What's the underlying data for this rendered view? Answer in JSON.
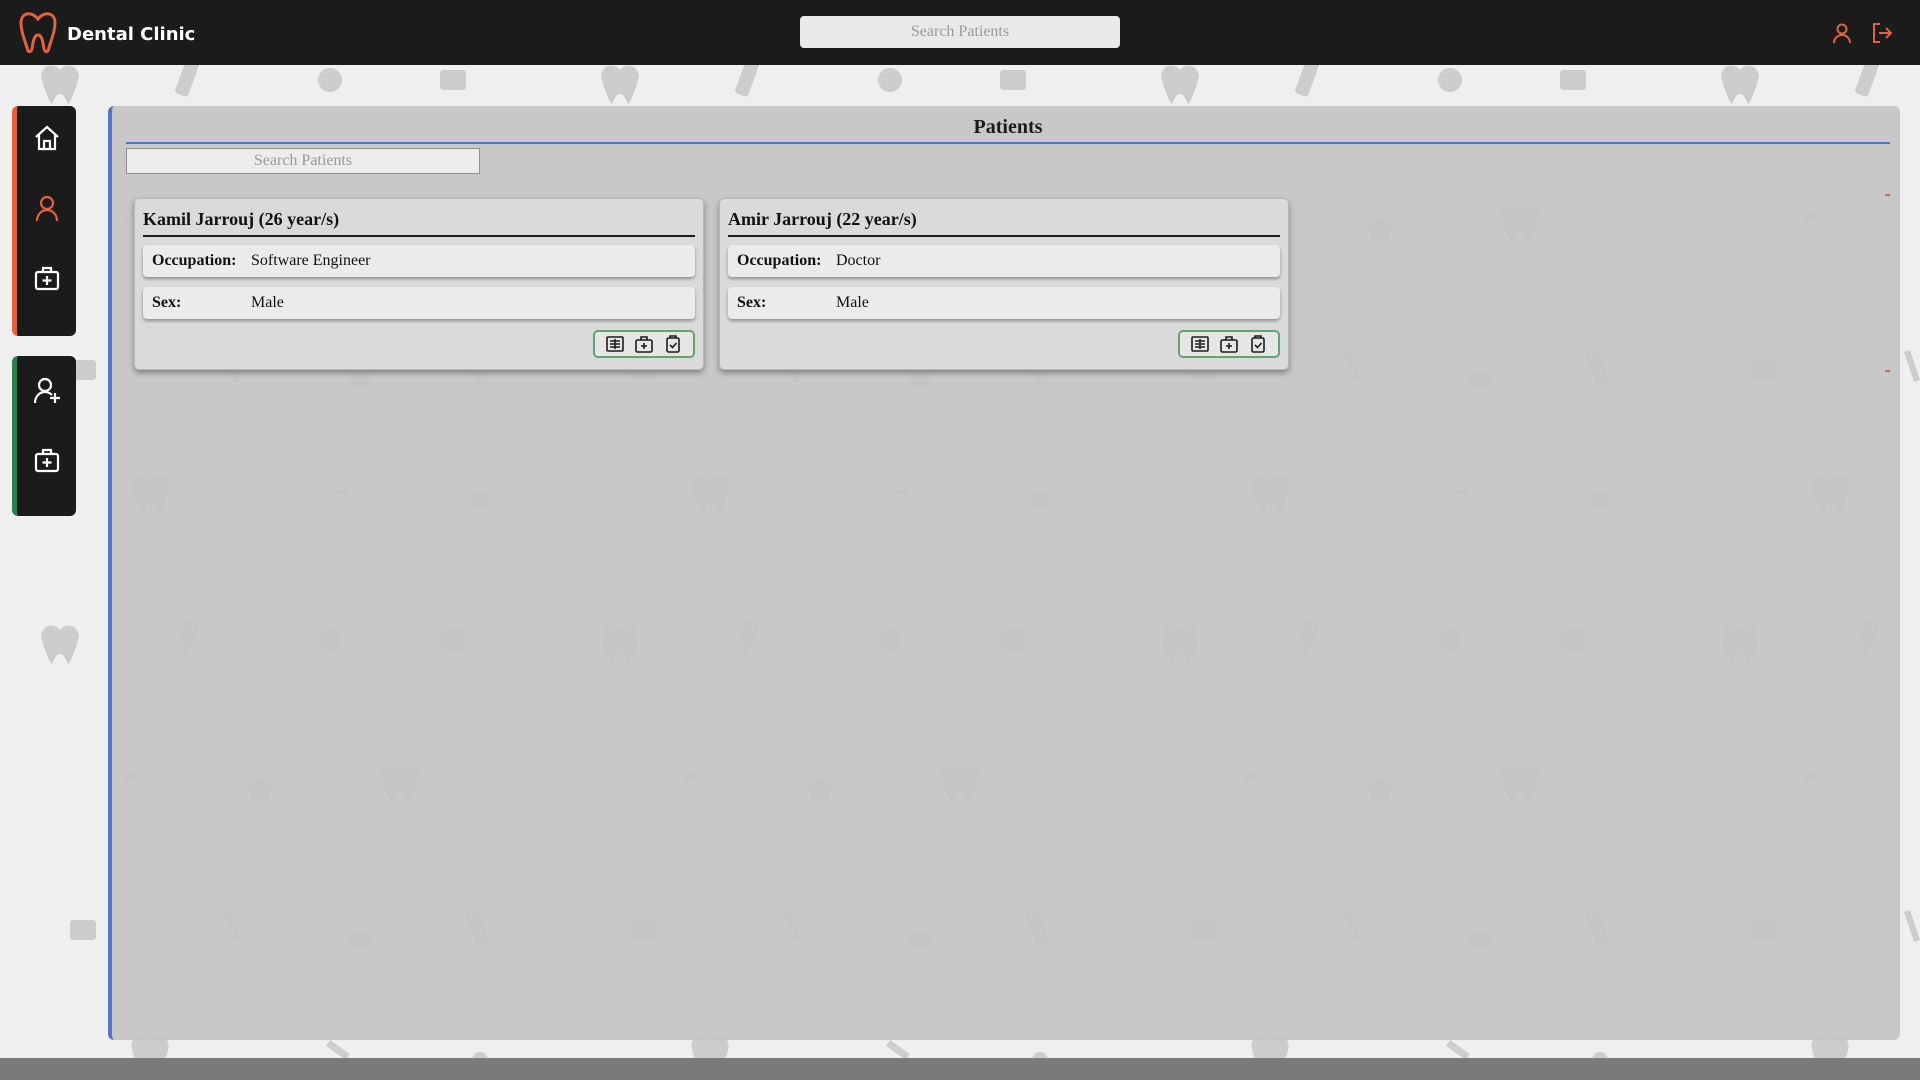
{
  "app": {
    "name": "Dental Clinic"
  },
  "header": {
    "search_placeholder": "Search Patients"
  },
  "panel": {
    "title": "Patients",
    "search_placeholder": "Search Patients"
  },
  "patients": [
    {
      "name": "Kamil Jarrouj (26 year/s)",
      "occupation_label": "Occupation:",
      "occupation": "Software Engineer",
      "sex_label": "Sex:",
      "sex": "Male"
    },
    {
      "name": "Amir Jarrouj (22 year/s)",
      "occupation_label": "Occupation:",
      "occupation": "Doctor",
      "sex_label": "Sex:",
      "sex": "Male"
    }
  ],
  "icons": {
    "logo": "tooth-logo-icon",
    "profile": "user-icon",
    "logout": "logout-icon",
    "nav": [
      "home-icon",
      "user-icon",
      "medical-kit-icon",
      "add-user-icon",
      "medical-kit-icon"
    ],
    "card_actions": [
      "xray-icon",
      "medical-kit-icon",
      "clipboard-check-icon"
    ]
  },
  "colors": {
    "accent": "#e0623f",
    "secondary": "#2f7d4a",
    "panel_accent": "#5472c8",
    "dark": "#1b1b1b"
  }
}
